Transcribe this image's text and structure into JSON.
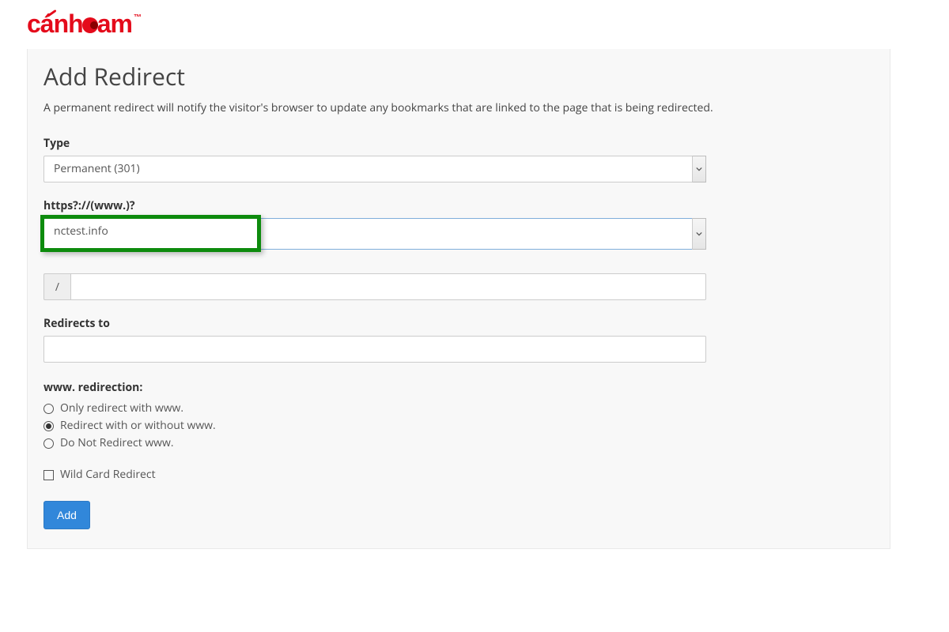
{
  "brand": {
    "name_left": "c",
    "name_mid": "nh",
    "name_right": "am",
    "accent_letter": "á",
    "tm": "™"
  },
  "page": {
    "title": "Add Redirect",
    "subtitle": "A permanent redirect will notify the visitor's browser to update any bookmarks that are linked to the page that is being redirected."
  },
  "type": {
    "label": "Type",
    "selected": "Permanent (301)"
  },
  "domain": {
    "label": "https?://(www.)?",
    "selected": "nctest.info"
  },
  "path": {
    "prefix": "/",
    "value": ""
  },
  "redirects_to": {
    "label": "Redirects to",
    "value": ""
  },
  "www_redirection": {
    "label": "www. redirection:",
    "options": [
      {
        "label": "Only redirect with www.",
        "checked": false
      },
      {
        "label": "Redirect with or without www.",
        "checked": true
      },
      {
        "label": "Do Not Redirect www.",
        "checked": false
      }
    ]
  },
  "wildcard": {
    "label": "Wild Card Redirect",
    "checked": false
  },
  "buttons": {
    "add": "Add"
  }
}
